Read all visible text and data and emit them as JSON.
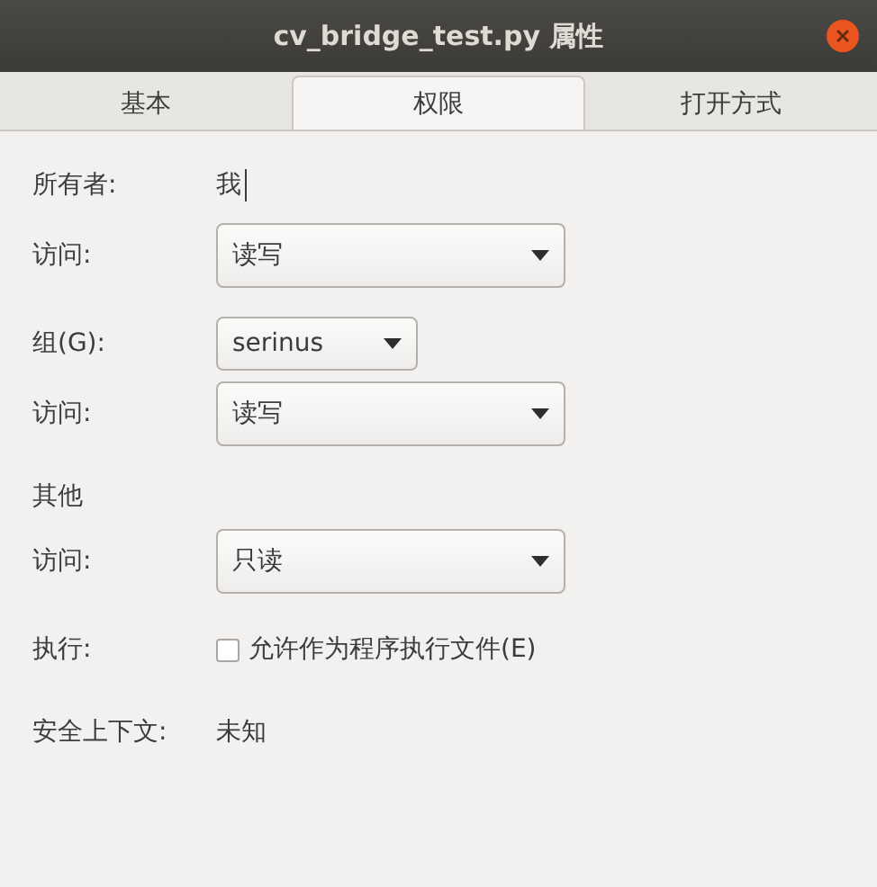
{
  "window": {
    "title": "cv_bridge_test.py 属性"
  },
  "tabs": [
    {
      "label": "基本",
      "selected": false
    },
    {
      "label": "权限",
      "selected": true
    },
    {
      "label": "打开方式",
      "selected": false
    }
  ],
  "sections": [
    [
      {
        "kind": "text",
        "label": "所有者:",
        "value": "我"
      },
      {
        "kind": "combo",
        "label": "访问:",
        "value": "读写"
      }
    ],
    [
      {
        "kind": "short_combo",
        "label": "组(G):",
        "value": "serinus"
      },
      {
        "kind": "combo",
        "label": "访问:",
        "value": "读写"
      }
    ],
    [
      {
        "kind": "heading",
        "label": "其他"
      },
      {
        "kind": "combo",
        "label": "访问:",
        "value": "只读"
      }
    ],
    [
      {
        "kind": "checkbox",
        "label": "执行:",
        "value": "允许作为程序执行文件(E)",
        "checked": false
      }
    ],
    [
      {
        "kind": "plain",
        "label": "安全上下文:",
        "value": "未知"
      }
    ]
  ]
}
